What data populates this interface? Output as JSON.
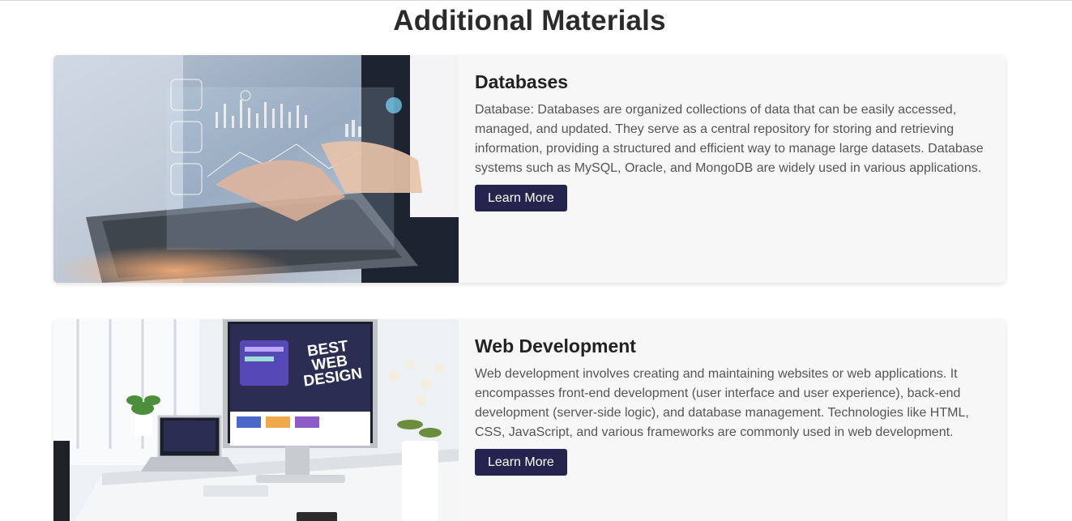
{
  "page": {
    "title": "Additional Materials"
  },
  "cards": [
    {
      "title": "Databases",
      "description": "Database: Databases are organized collections of data that can be easily accessed, managed, and updated. They serve as a central repository for storing and retrieving information, providing a structured and efficient way to manage large datasets. Database systems such as MySQL, Oracle, and MongoDB are widely used in various applications.",
      "button_label": "Learn More",
      "image": "databases-photo"
    },
    {
      "title": "Web Development",
      "description": "Web development involves creating and maintaining websites or web applications. It encompasses front-end development (user interface and user experience), back-end development (server-side logic), and database management. Technologies like HTML, CSS, JavaScript, and various frameworks are commonly used in web development.",
      "button_label": "Learn More",
      "image": "web-development-photo",
      "image_text": {
        "line1": "BEST",
        "line2": "WEB",
        "line3": "DESIGN"
      }
    }
  ],
  "colors": {
    "button": "#25244f",
    "card_bg": "#f7f7f7",
    "text": "#555555",
    "heading": "#222222"
  }
}
